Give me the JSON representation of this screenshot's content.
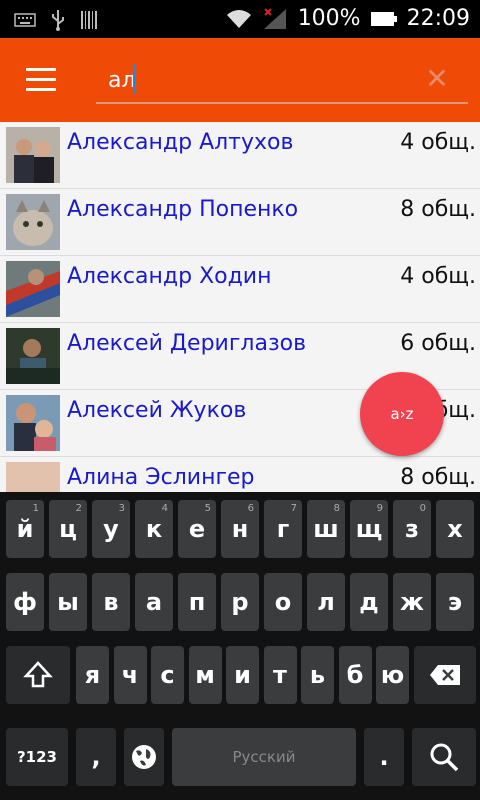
{
  "status_bar": {
    "battery": "100%",
    "time": "22:09"
  },
  "toolbar": {
    "menu_icon": "hamburger-icon",
    "search_value": "ал",
    "clear_icon": "close-icon"
  },
  "contacts": [
    {
      "name": "Александр Алтухов",
      "mutual": "4 общ."
    },
    {
      "name": "Александр Попенко",
      "mutual": "8 общ."
    },
    {
      "name": "Александр Ходин",
      "mutual": "4 общ."
    },
    {
      "name": "Алексей Дериглазов",
      "mutual": "6 общ."
    },
    {
      "name": "Алексей Жуков",
      "mutual": "общ."
    },
    {
      "name": "Алина Эслингер",
      "mutual": "8 общ."
    }
  ],
  "fab": {
    "label": "a›z"
  },
  "keyboard": {
    "row1": [
      {
        "k": "й",
        "h": "1"
      },
      {
        "k": "ц",
        "h": "2"
      },
      {
        "k": "у",
        "h": "3"
      },
      {
        "k": "к",
        "h": "4"
      },
      {
        "k": "е",
        "h": "5"
      },
      {
        "k": "н",
        "h": "6"
      },
      {
        "k": "г",
        "h": "7"
      },
      {
        "k": "ш",
        "h": "8"
      },
      {
        "k": "щ",
        "h": "9"
      },
      {
        "k": "з",
        "h": "0"
      },
      {
        "k": "х",
        "h": ""
      }
    ],
    "row2": [
      "ф",
      "ы",
      "в",
      "а",
      "п",
      "р",
      "о",
      "л",
      "д",
      "ж",
      "э"
    ],
    "row3": [
      "я",
      "ч",
      "с",
      "м",
      "и",
      "т",
      "ь",
      "б",
      "ю"
    ],
    "symbols_label": "?123",
    "comma": ",",
    "space_label": "Русский",
    "period": "."
  }
}
